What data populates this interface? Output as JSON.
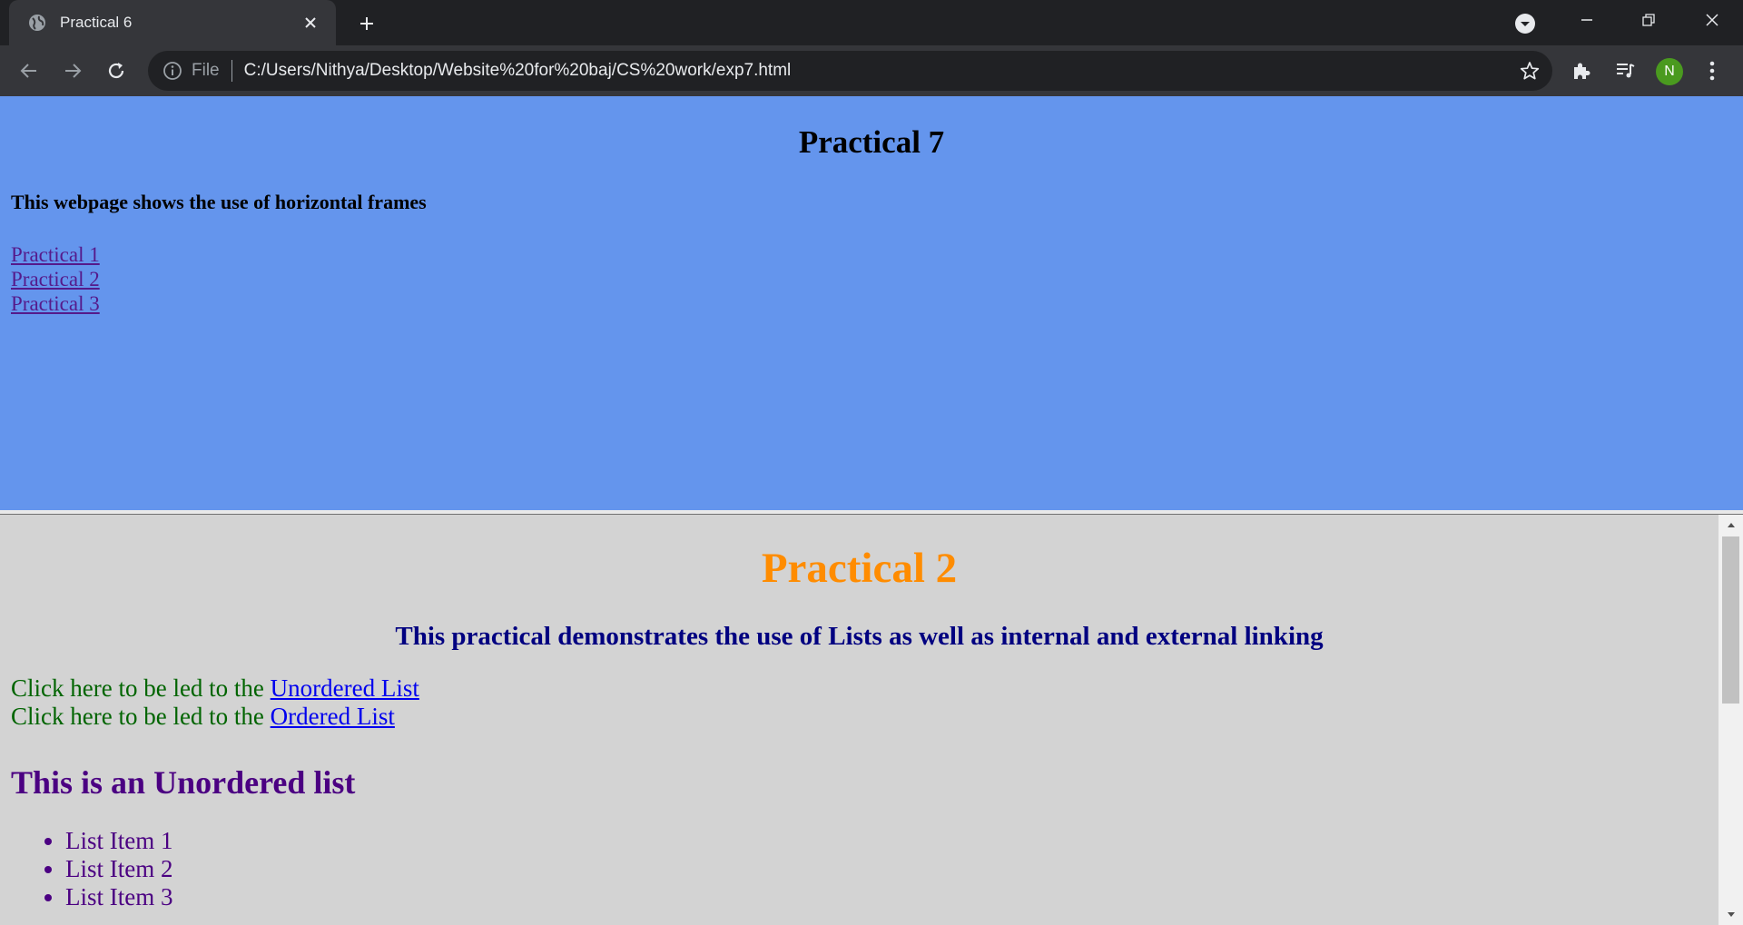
{
  "browser": {
    "tab_title": "Practical 6",
    "omnibox_scheme_label": "File",
    "url": "C:/Users/Nithya/Desktop/Website%20for%20baj/CS%20work/exp7.html",
    "profile_initial": "N"
  },
  "top_frame": {
    "heading": "Practical 7",
    "subtitle": "This webpage shows the use of horizontal frames",
    "links": [
      "Practical 1",
      "Practical 2",
      "Practical 3"
    ]
  },
  "bottom_frame": {
    "heading": "Practical 2",
    "subheading": "This practical demonstrates the use of Lists as well as internal and external linking",
    "jump_prefix": "Click here to be led to the",
    "jump_links": [
      "Unordered List",
      "Ordered List"
    ],
    "list_heading": "This is an Unordered list",
    "list_items": [
      "List Item 1",
      "List Item 2",
      "List Item 3"
    ]
  },
  "colors": {
    "top_frame_bg": "#6495ed",
    "bottom_frame_bg": "#d3d3d3",
    "heading_orange": "#ff8c00",
    "subheading_navy": "#000080",
    "jump_text_green": "#006400",
    "list_purple": "#4b0082"
  }
}
